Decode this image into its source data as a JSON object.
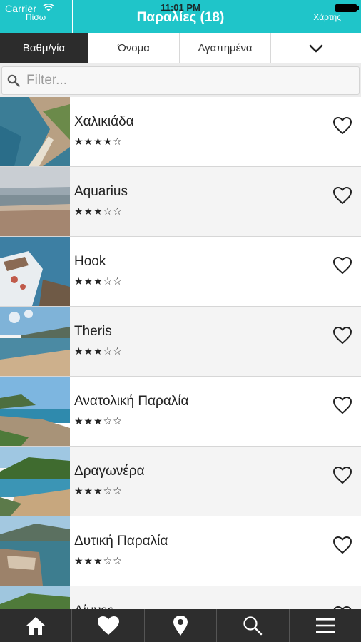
{
  "status_bar": {
    "carrier": "Carrier",
    "time": "11:01 PM"
  },
  "nav": {
    "back_label": "Πίσω",
    "title": "Παραλίες (18)",
    "map_label": "Χάρτης"
  },
  "tabs": [
    {
      "label": "Βαθμ/γία",
      "active": true
    },
    {
      "label": "Όνομα",
      "active": false
    },
    {
      "label": "Αγαπημένα",
      "active": false
    }
  ],
  "dropdown_icon": "chevron-down-icon",
  "search": {
    "placeholder": "Filter...",
    "value": ""
  },
  "beaches": [
    {
      "name": "Χαλικιάδα",
      "stars": "★★★★☆",
      "rating": 4,
      "favorite": false
    },
    {
      "name": "Aquarius",
      "stars": "★★★☆☆",
      "rating": 3,
      "favorite": false
    },
    {
      "name": "Hook",
      "stars": "★★★☆☆",
      "rating": 3,
      "favorite": false
    },
    {
      "name": "Theris",
      "stars": "★★★☆☆",
      "rating": 3,
      "favorite": false
    },
    {
      "name": "Ανατολική Παραλία",
      "stars": "★★★☆☆",
      "rating": 3,
      "favorite": false
    },
    {
      "name": "Δραγωνέρα",
      "stars": "★★★☆☆",
      "rating": 3,
      "favorite": false
    },
    {
      "name": "Δυτική Παραλία",
      "stars": "★★★☆☆",
      "rating": 3,
      "favorite": false
    },
    {
      "name": "Λίμνες",
      "stars": "",
      "rating": null,
      "favorite": false
    }
  ],
  "bottom_bar": [
    {
      "icon": "home-icon"
    },
    {
      "icon": "heart-icon"
    },
    {
      "icon": "map-pin-icon"
    },
    {
      "icon": "search-icon"
    },
    {
      "icon": "menu-icon"
    }
  ],
  "colors": {
    "accent": "#1fc5c9",
    "tab_active": "#2c2c2c",
    "bottom_bar": "#2d2d2d"
  }
}
